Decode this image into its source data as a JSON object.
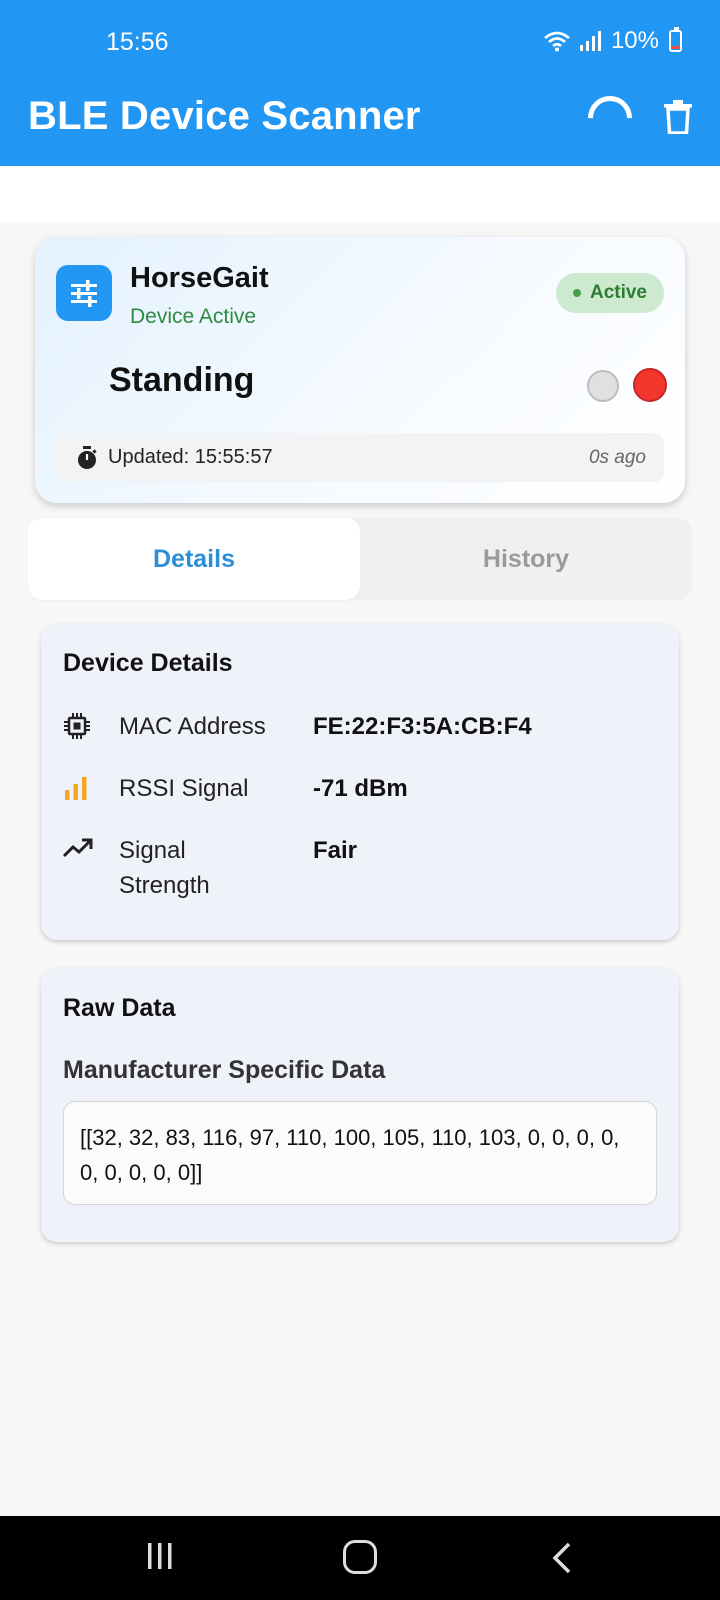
{
  "status_bar": {
    "time": "15:56",
    "battery": "10%",
    "icons": [
      "wifi-icon",
      "signal-icon",
      "battery-icon"
    ]
  },
  "app_bar": {
    "title": "BLE Device Scanner",
    "actions": [
      "loading-spinner-icon",
      "delete-icon"
    ]
  },
  "device_card": {
    "name": "HorseGait",
    "subtitle": "Device Active",
    "badge": "Active",
    "gait_state": "Standing",
    "updated": "Updated: 15:55:57",
    "ago": "0s ago",
    "icon": "tune-icon"
  },
  "tabs": [
    {
      "label": "Details",
      "active": true
    },
    {
      "label": "History",
      "active": false
    }
  ],
  "details_card": {
    "title": "Device Details",
    "rows": [
      {
        "icon": "chip-icon",
        "label": "MAC Address",
        "value": "FE:22:F3:5A:CB:F4"
      },
      {
        "icon": "signal-bars-icon",
        "label": "RSSI Signal",
        "value": "-71 dBm"
      },
      {
        "icon": "trending-up-icon",
        "label": "Signal Strength",
        "value": "Fair"
      }
    ]
  },
  "raw_card": {
    "title": "Raw Data",
    "subtitle": "Manufacturer Specific Data",
    "data": "[[32, 32, 83, 116, 97, 110, 100, 105, 110, 103, 0, 0, 0, 0, 0, 0, 0, 0, 0]]"
  },
  "colors": {
    "primary": "#2196f3",
    "active_green": "#2e7d32",
    "alert_red": "#f2362b",
    "rssi_orange": "#f5a623"
  }
}
